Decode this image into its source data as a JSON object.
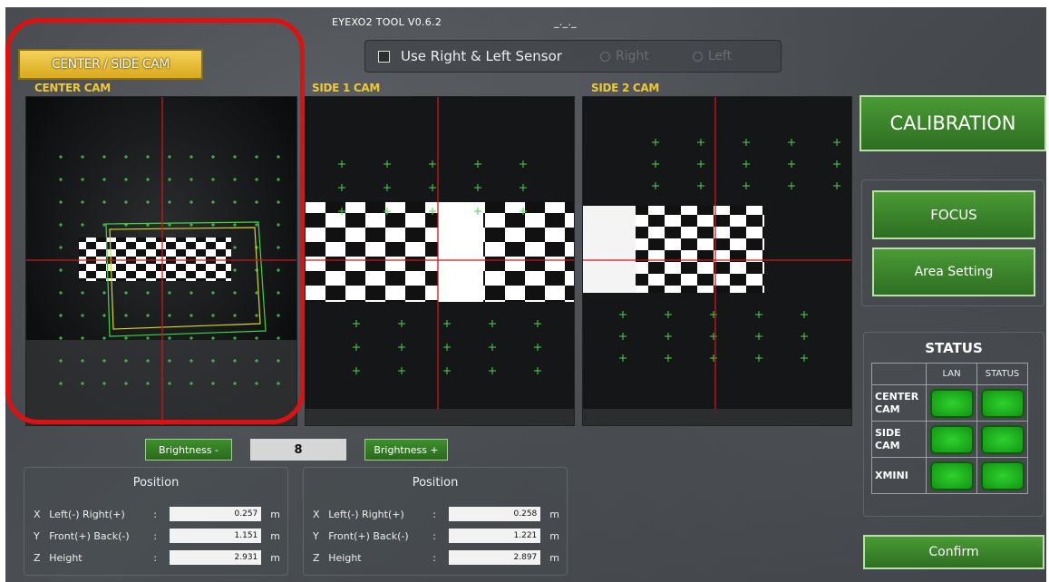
{
  "window": {
    "title": "EYEXO2 TOOL V0.6.2",
    "subtitle": "_._._"
  },
  "mode_button": {
    "label": "CENTER / SIDE CAM"
  },
  "sensor": {
    "checkbox_label": "Use Right & Left Sensor",
    "checked": false,
    "radio_right": "Right",
    "radio_left": "Left"
  },
  "cameras": [
    {
      "label": "CENTER CAM"
    },
    {
      "label": "SIDE 1 CAM"
    },
    {
      "label": "SIDE 2 CAM"
    }
  ],
  "brightness": {
    "minus_label": "Brightness -",
    "value": "8",
    "plus_label": "Brightness +"
  },
  "position_left": {
    "title": "Position",
    "rows": [
      {
        "axis": "X",
        "name": "Left(-) Right(+)",
        "value": "0.257",
        "unit": "m"
      },
      {
        "axis": "Y",
        "name": "Front(+) Back(-)",
        "value": "1.151",
        "unit": "m"
      },
      {
        "axis": "Z",
        "name": "Height",
        "value": "2.931",
        "unit": "m"
      }
    ]
  },
  "position_right": {
    "title": "Position",
    "rows": [
      {
        "axis": "X",
        "name": "Left(-) Right(+)",
        "value": "0.258",
        "unit": "m"
      },
      {
        "axis": "Y",
        "name": "Front(+) Back(-)",
        "value": "1.221",
        "unit": "m"
      },
      {
        "axis": "Z",
        "name": "Height",
        "value": "2.897",
        "unit": "m"
      }
    ]
  },
  "calibration": {
    "label": "CALIBRATION"
  },
  "focus": {
    "label": "FOCUS"
  },
  "area_setting": {
    "label": "Area Setting"
  },
  "status": {
    "title": "STATUS",
    "col_lan": "LAN",
    "col_status": "STATUS",
    "rows": [
      {
        "label_line1": "CENTER",
        "label_line2": "CAM",
        "lan": "ok",
        "status": "ok"
      },
      {
        "label_line1": "SIDE",
        "label_line2": "CAM",
        "lan": "ok",
        "status": "ok"
      },
      {
        "label_line1": "XMINI",
        "label_line2": "",
        "lan": "ok",
        "status": "ok"
      }
    ]
  },
  "confirm": {
    "label": "Confirm"
  },
  "colors": {
    "accent_green": "#3b8a2b",
    "highlight_red": "#e01010",
    "label_yellow": "#f0c830",
    "status_ok": "#22c022"
  }
}
